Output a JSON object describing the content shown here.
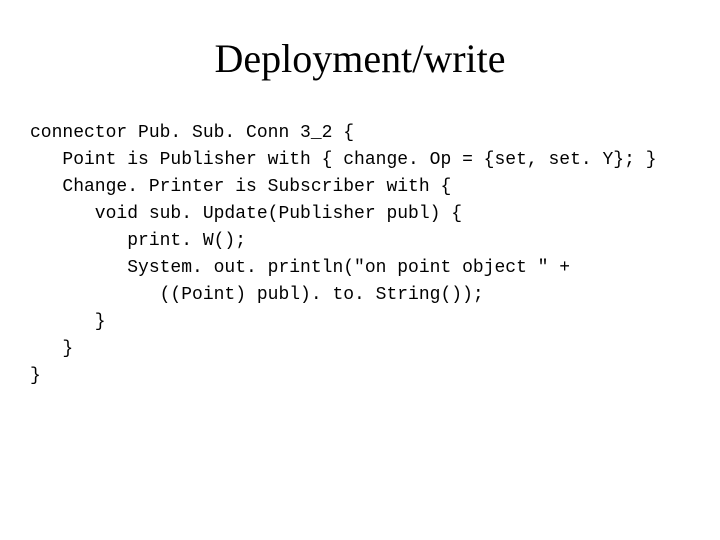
{
  "title": "Deployment/write",
  "code": {
    "line1": "connector Pub. Sub. Conn 3_2 {",
    "line2": "   Point is Publisher with { change. Op = {set, set. Y}; }",
    "line3": "   Change. Printer is Subscriber with {",
    "line4": "      void sub. Update(Publisher publ) {",
    "line5": "         print. W();",
    "line6": "         System. out. println(\"on point object \" +",
    "line7": "            ((Point) publ). to. String());",
    "line8": "      }",
    "line9": "   }",
    "line10": "}"
  }
}
